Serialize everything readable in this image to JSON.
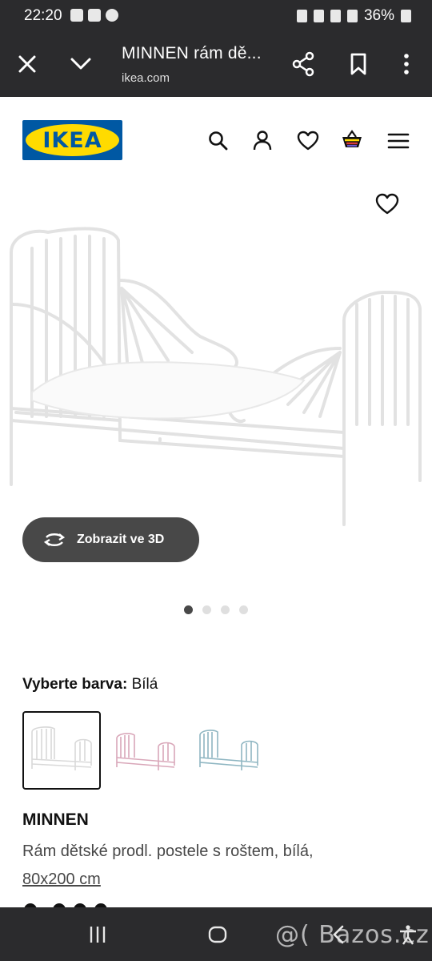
{
  "status_bar": {
    "time": "22:20",
    "battery": "36%",
    "icons": [
      "image-icon",
      "youtube-icon",
      "facebook-icon"
    ]
  },
  "browser": {
    "title": "MINNEN rám dě...",
    "url": "ikea.com"
  },
  "site": {
    "logo_text": "IKEA",
    "brand_colors": {
      "blue": "#0058a3",
      "yellow": "#ffdb00"
    }
  },
  "gallery": {
    "view_3d_label": "Zobrazit ve 3D",
    "dots_total": 4,
    "active_dot": 1
  },
  "color_selector": {
    "label": "Vyberte barva:",
    "selected_value": "Bílá",
    "options": [
      "white",
      "pink",
      "light-blue"
    ]
  },
  "product": {
    "name": "MINNEN",
    "description": "Rám dětské prodl. postele s roštem, bílá,",
    "size": "80x200 cm"
  },
  "watermark": "@( Bazos.cz"
}
